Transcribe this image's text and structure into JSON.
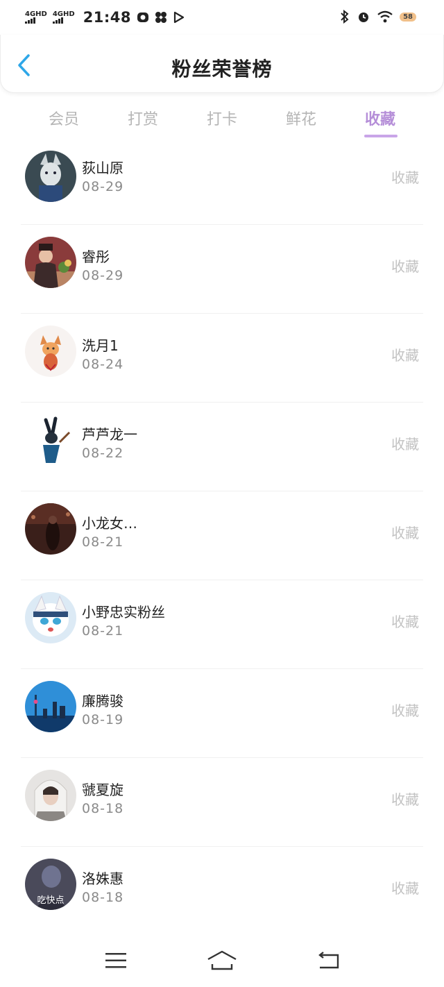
{
  "status_bar": {
    "network1": "4GHD",
    "network2": "4GHD",
    "time": "21:48",
    "battery": "58"
  },
  "header": {
    "title": "粉丝荣誉榜"
  },
  "tabs": [
    {
      "label": "会员",
      "active": false
    },
    {
      "label": "打赏",
      "active": false
    },
    {
      "label": "打卡",
      "active": false
    },
    {
      "label": "鲜花",
      "active": false
    },
    {
      "label": "收藏",
      "active": true
    }
  ],
  "list": [
    {
      "name": "荻山原",
      "date": "08-29",
      "action": "收藏",
      "avatar_icon": "wolf-avatar-icon"
    },
    {
      "name": "睿彤",
      "date": "08-29",
      "action": "收藏",
      "avatar_icon": "person-plant-avatar-icon"
    },
    {
      "name": "洗月1",
      "date": "08-24",
      "action": "收藏",
      "avatar_icon": "fox-sticker-avatar-icon"
    },
    {
      "name": "芦芦龙一",
      "date": "08-22",
      "action": "收藏",
      "avatar_icon": "rabbit-warrior-avatar-icon"
    },
    {
      "name": "小龙女…",
      "date": "08-21",
      "action": "收藏",
      "avatar_icon": "dark-scene-avatar-icon"
    },
    {
      "name": "小野忠实粉丝",
      "date": "08-21",
      "action": "收藏",
      "avatar_icon": "cartoon-cat-avatar-icon"
    },
    {
      "name": "廉腾骏",
      "date": "08-19",
      "action": "收藏",
      "avatar_icon": "city-skyline-avatar-icon"
    },
    {
      "name": "虢夏旋",
      "date": "08-18",
      "action": "收藏",
      "avatar_icon": "hooded-person-avatar-icon"
    },
    {
      "name": "洛姝惠",
      "date": "08-18",
      "action": "收藏",
      "avatar_icon": "dark-figure-avatar-icon",
      "avatar_caption": "吃快点"
    }
  ],
  "colors": {
    "accent": "#b58ed8",
    "back_arrow": "#2ea7e8",
    "muted": "#c2c2c2"
  }
}
